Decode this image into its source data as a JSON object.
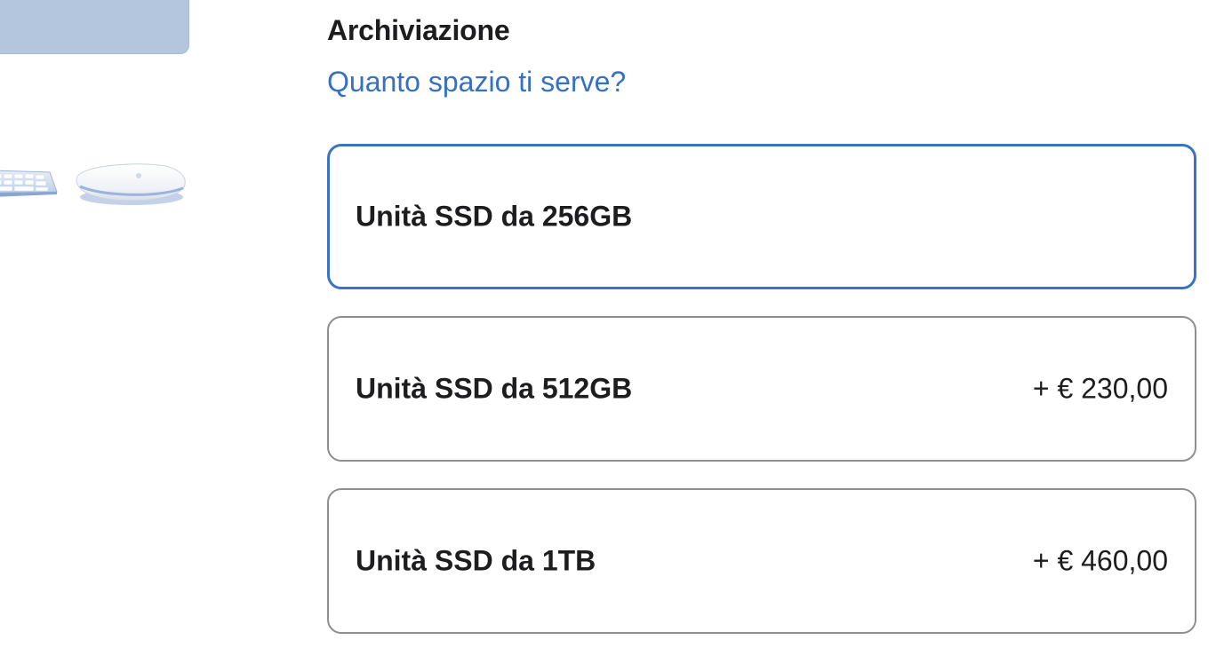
{
  "preview": {
    "swatch_color": "#b3c6de",
    "keyboard_icon": "keyboard-icon",
    "mouse_icon": "magic-mouse-icon"
  },
  "storage": {
    "title": "Archiviazione",
    "help_link": "Quanto spazio ti serve?",
    "accent_color": "#3a73c6",
    "options": [
      {
        "label": "Unità SSD da 256GB",
        "price": "",
        "selected": true
      },
      {
        "label": "Unità SSD da 512GB",
        "price": "+ € 230,00",
        "selected": false
      },
      {
        "label": "Unità SSD da 1TB",
        "price": "+ € 460,00",
        "selected": false
      }
    ]
  }
}
